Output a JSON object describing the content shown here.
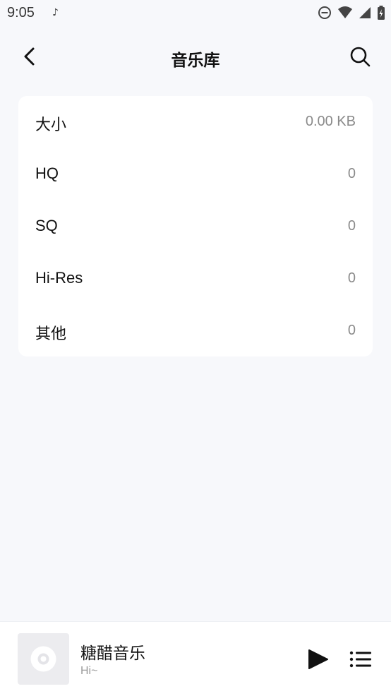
{
  "status_bar": {
    "time": "9:05",
    "notification": "♪",
    "icons": [
      "do-not-disturb-icon",
      "wifi-icon",
      "signal-icon",
      "battery-charging-icon"
    ]
  },
  "header": {
    "title": "音乐库",
    "back_icon": "chevron-left-icon",
    "search_icon": "search-icon"
  },
  "library_stats": [
    {
      "label": "大小",
      "value": "0.00 KB"
    },
    {
      "label": "HQ",
      "value": "0"
    },
    {
      "label": "SQ",
      "value": "0"
    },
    {
      "label": "Hi-Res",
      "value": "0"
    },
    {
      "label": "其他",
      "value": "0"
    }
  ],
  "player": {
    "title": "糖醋音乐",
    "subtitle": "Hi~",
    "cover_icon": "disc-icon",
    "play_icon": "play-icon",
    "queue_icon": "playlist-icon"
  },
  "colors": {
    "background": "#f7f8fb",
    "card": "#ffffff",
    "text_primary": "#111111",
    "text_secondary": "#8a8a8a"
  }
}
